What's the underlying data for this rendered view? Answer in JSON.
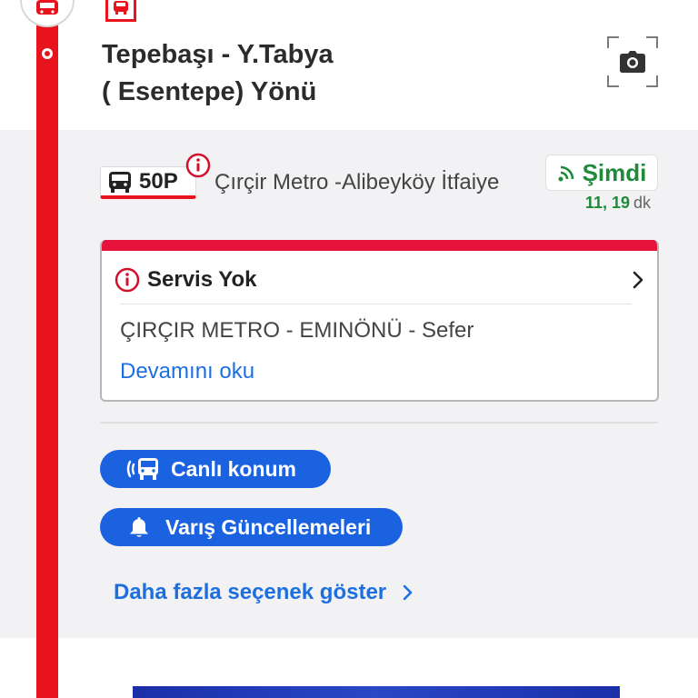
{
  "stop": {
    "title_line1": "Tepebaşı - Y.Tabya",
    "title_line2": "( Esentepe) Yönü"
  },
  "route": {
    "number": "50P",
    "destination": "Çırçir Metro -Alibeyköy İtfaiye",
    "live_label": "Şimdi",
    "arrival_times": "11, 19",
    "arrival_unit": "dk"
  },
  "alert_card": {
    "title": "Servis Yok",
    "body": "ÇIRÇIR METRO - EMINÖNÜ - Sefer",
    "link": "Devamını oku"
  },
  "actions": {
    "live_location": "Canlı konum",
    "arrival_updates": "Varış Güncellemeleri",
    "more_options": "Daha fazla seçenek göster"
  },
  "colors": {
    "route_line": "#e8131c",
    "alert_stripe": "#e8133c",
    "primary_blue": "#1b62e0",
    "live_green": "#1f8a3a"
  },
  "icons": {
    "stop": "bus-icon",
    "camera": "camera-icon",
    "route": "bus-icon",
    "alert": "info-alert-icon",
    "live": "live-signal-icon",
    "card_chevron": "chevron-right-icon",
    "live_location": "live-bus-icon",
    "arrival_updates": "bell-icon",
    "more_chevron": "chevron-right-icon"
  }
}
